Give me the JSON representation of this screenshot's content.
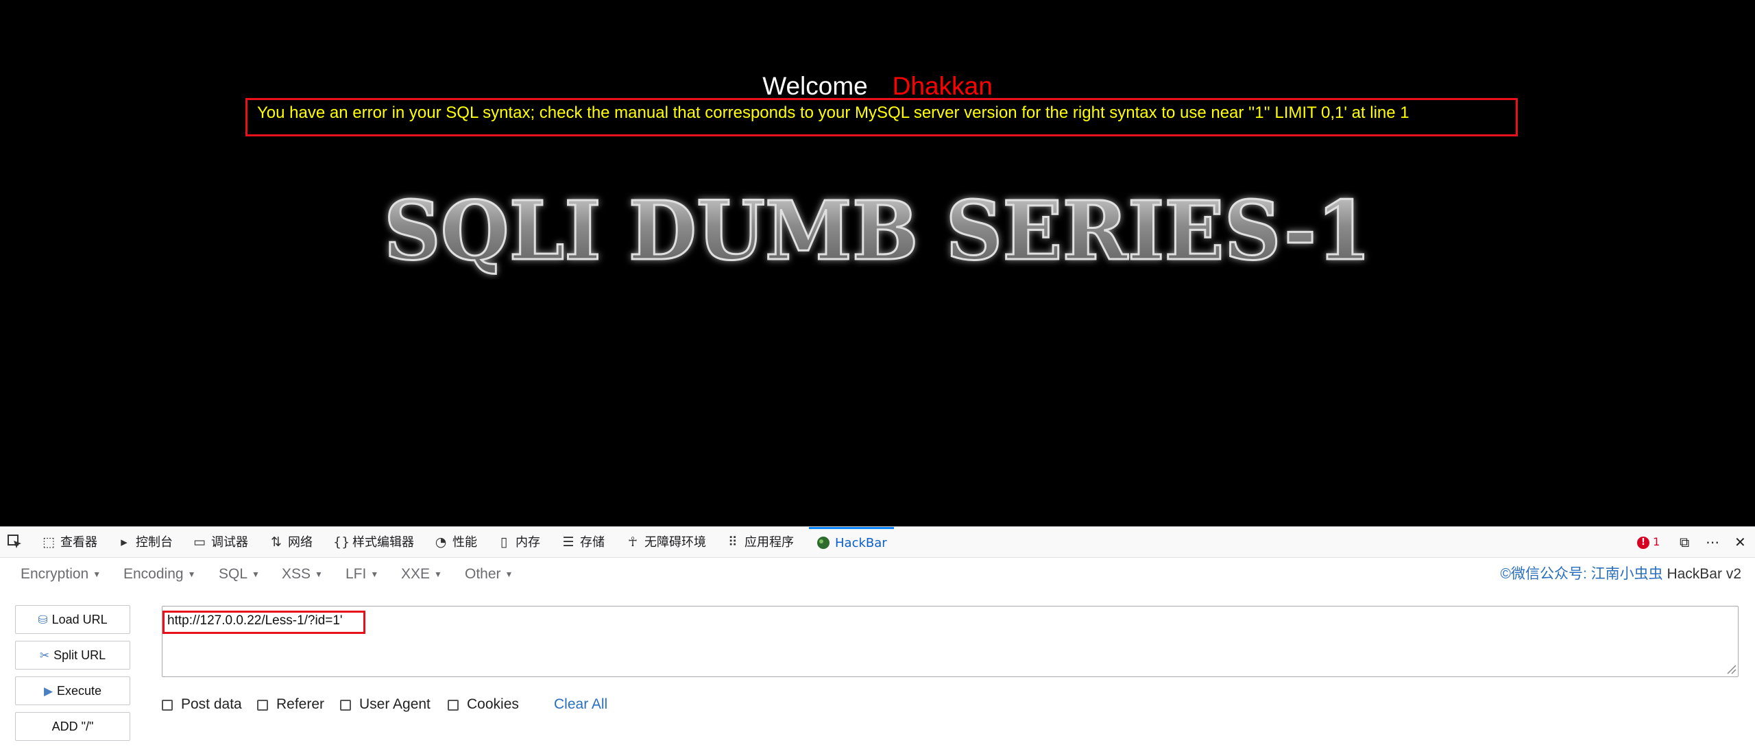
{
  "page": {
    "welcome_label": "Welcome",
    "username": "Dhakkan",
    "error_message": "You have an error in your SQL syntax; check the manual that corresponds to your MySQL server version for the right syntax to use near ''1'' LIMIT 0,1' at line 1",
    "banner_text": "SQLI DUMB SERIES-1"
  },
  "devtools": {
    "tabs": [
      {
        "label": "查看器",
        "icon": "inspector-icon"
      },
      {
        "label": "控制台",
        "icon": "console-icon"
      },
      {
        "label": "调试器",
        "icon": "debugger-icon"
      },
      {
        "label": "网络",
        "icon": "network-icon"
      },
      {
        "label": "样式编辑器",
        "icon": "style-editor-icon"
      },
      {
        "label": "性能",
        "icon": "performance-icon"
      },
      {
        "label": "内存",
        "icon": "memory-icon"
      },
      {
        "label": "存储",
        "icon": "storage-icon"
      },
      {
        "label": "无障碍环境",
        "icon": "accessibility-icon"
      },
      {
        "label": "应用程序",
        "icon": "application-icon"
      },
      {
        "label": "HackBar",
        "icon": "hackbar-icon",
        "active": true
      }
    ],
    "error_count": "1"
  },
  "hackbar": {
    "menus": [
      "Encryption",
      "Encoding",
      "SQL",
      "XSS",
      "LFI",
      "XXE",
      "Other"
    ],
    "copyright_prefix": "©微信公众号: 江南小虫虫",
    "copyright_suffix": " HackBar v2",
    "buttons": {
      "load_url": "Load URL",
      "split_url": "Split URL",
      "execute": "Execute",
      "add_slash": "ADD \"/\""
    },
    "url_value": "http://127.0.0.22/Less-1/?id=1'",
    "options": {
      "post_data": "Post data",
      "referer": "Referer",
      "user_agent": "User Agent",
      "cookies": "Cookies"
    },
    "clear_all": "Clear All"
  },
  "colors": {
    "username": "#ff0000",
    "error_text": "#ffff00",
    "highlight_box": "#e8101a",
    "active_tab": "#0a84ff"
  }
}
